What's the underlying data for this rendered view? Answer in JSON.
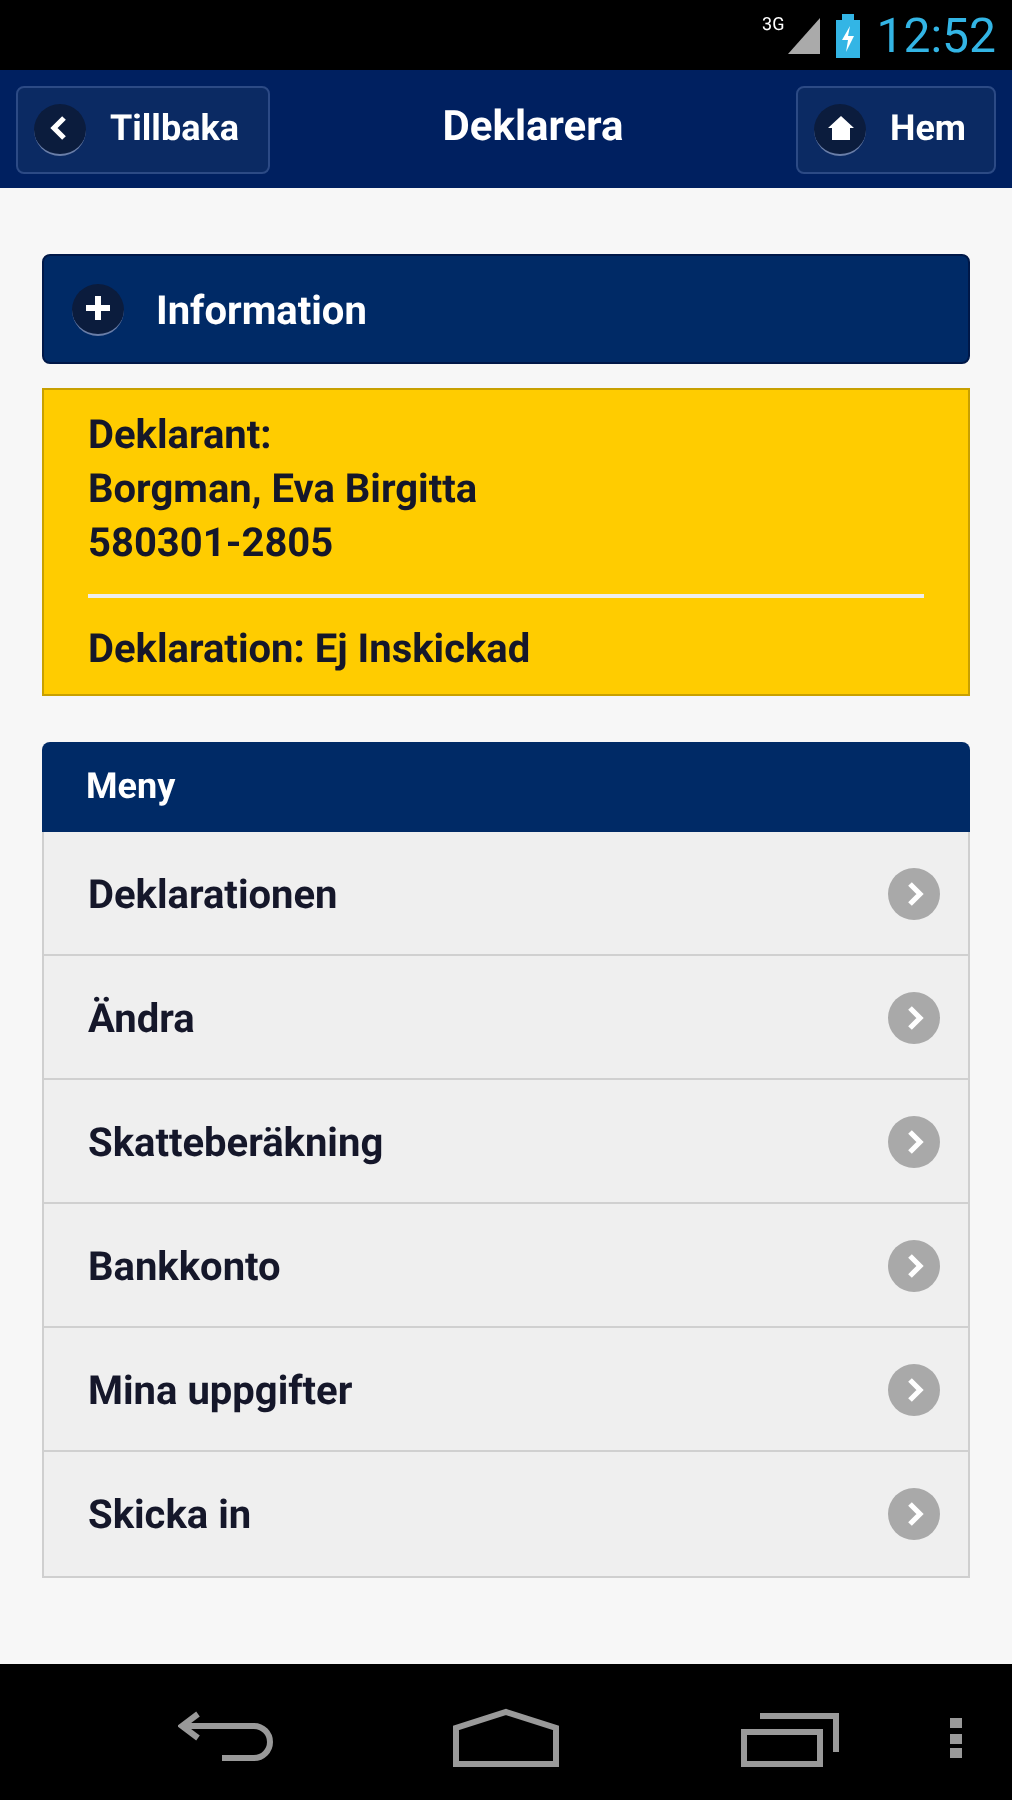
{
  "status_bar": {
    "network": "3G",
    "time": "12:52"
  },
  "header": {
    "back": "Tillbaka",
    "title": "Deklarera",
    "home": "Hem"
  },
  "information": {
    "label": "Information",
    "expanded": false
  },
  "declarant": {
    "label": "Deklarant:",
    "name": "Borgman, Eva Birgitta",
    "id_number": "580301-2805",
    "status": "Deklaration: Ej Inskickad"
  },
  "menu": {
    "title": "Meny",
    "items": [
      {
        "label": "Deklarationen"
      },
      {
        "label": "Ändra"
      },
      {
        "label": "Skatteberäkning"
      },
      {
        "label": "Bankkonto"
      },
      {
        "label": "Mina uppgifter"
      },
      {
        "label": "Skicka in"
      }
    ]
  }
}
